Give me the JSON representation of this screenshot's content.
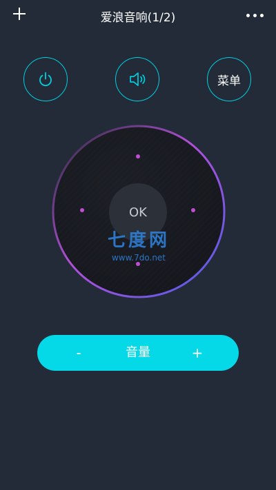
{
  "header": {
    "title": "爱浪音响(1/2)",
    "add_icon": "plus-icon",
    "more_icon": "more-dots-icon"
  },
  "controls": {
    "power_icon": "power-icon",
    "sound_icon": "speaker-icon",
    "menu_label": "菜单"
  },
  "dpad": {
    "ok_label": "OK",
    "dot_color": "#c04ed0"
  },
  "watermark": {
    "text": "七度网",
    "url": "www.7do.net"
  },
  "volume": {
    "minus_label": "-",
    "label": "音量",
    "plus_label": "+"
  },
  "colors": {
    "background": "#222b37",
    "accent": "#05d8e6",
    "ring_gradient": [
      "#b24fd8",
      "#4d5ee8"
    ]
  }
}
